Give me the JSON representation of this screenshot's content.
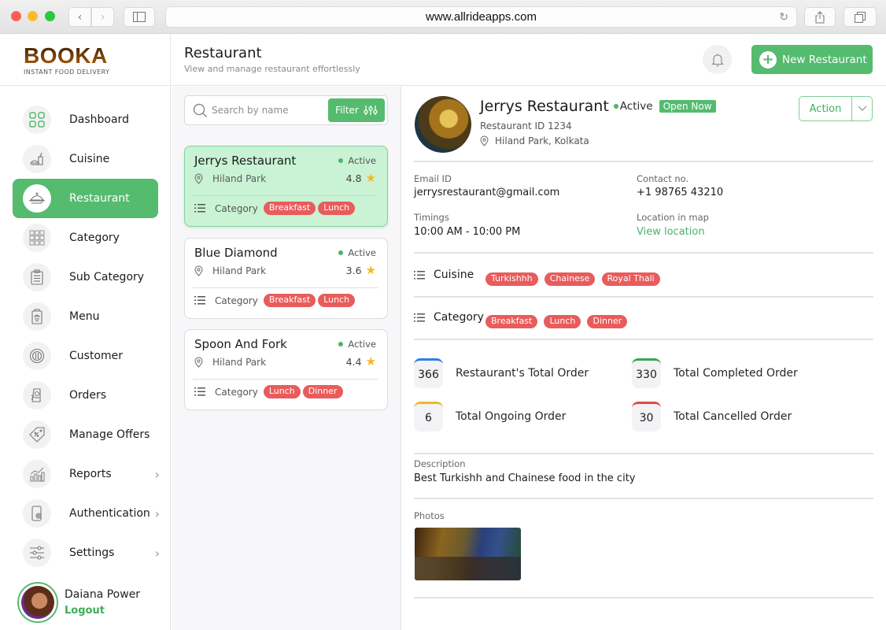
{
  "browser": {
    "url": "www.allrideapps.com"
  },
  "brand": {
    "name": "BOOKA",
    "tagline": "INSTANT FOOD DELIVERY"
  },
  "sidebar": {
    "items": [
      {
        "label": "Dashboard",
        "icon": "dashboard-icon",
        "active": false,
        "has_chevron": false
      },
      {
        "label": "Cuisine",
        "icon": "cuisine-icon",
        "active": false,
        "has_chevron": false
      },
      {
        "label": "Restaurant",
        "icon": "restaurant-cloche-icon",
        "active": true,
        "has_chevron": false
      },
      {
        "label": "Category",
        "icon": "category-grid-icon",
        "active": false,
        "has_chevron": false
      },
      {
        "label": "Sub Category",
        "icon": "clipboard-list-icon",
        "active": false,
        "has_chevron": false
      },
      {
        "label": "Menu",
        "icon": "menu-card-icon",
        "active": false,
        "has_chevron": false
      },
      {
        "label": "Customer",
        "icon": "customer-plate-icon",
        "active": false,
        "has_chevron": false
      },
      {
        "label": "Orders",
        "icon": "orders-icon",
        "active": false,
        "has_chevron": false
      },
      {
        "label": "Manage Offers",
        "icon": "offer-tag-icon",
        "active": false,
        "has_chevron": false
      },
      {
        "label": "Reports",
        "icon": "reports-chart-icon",
        "active": false,
        "has_chevron": true
      },
      {
        "label": "Authentication",
        "icon": "authentication-phone-icon",
        "active": false,
        "has_chevron": true
      },
      {
        "label": "Settings",
        "icon": "settings-sliders-icon",
        "active": false,
        "has_chevron": true
      }
    ],
    "user": {
      "name": "Daiana Power",
      "logout_label": "Logout"
    }
  },
  "header": {
    "title": "Restaurant",
    "subtitle": "View and manage restaurant effortlessly",
    "new_button_label": "New Restaurant"
  },
  "list": {
    "search_placeholder": "Search by name",
    "search_value": "",
    "filter_label": "Filter",
    "category_label": "Category",
    "restaurants": [
      {
        "name": "Jerrys Restaurant",
        "status": "Active",
        "location": "Hiland Park",
        "rating": "4.8",
        "categories": [
          "Breakfast",
          "Lunch"
        ],
        "selected": true
      },
      {
        "name": "Blue Diamond",
        "status": "Active",
        "location": "Hiland Park",
        "rating": "3.6",
        "categories": [
          "Breakfast",
          "Lunch"
        ],
        "selected": false
      },
      {
        "name": "Spoon And Fork",
        "status": "Active",
        "location": "Hiland Park",
        "rating": "4.4",
        "categories": [
          "Lunch",
          "Dinner"
        ],
        "selected": false
      }
    ]
  },
  "detail": {
    "name": "Jerrys Restaurant",
    "status": "Active",
    "open_badge": "Open Now",
    "restaurant_id": "Restaurant ID 1234",
    "location": "Hiland Park, Kolkata",
    "action_label": "Action",
    "email_label": "Email ID",
    "email": "jerrysrestaurant@gmail.com",
    "contact_label": "Contact no.",
    "contact": "+1 98765 43210",
    "timings_label": "Timings",
    "timings": "10:00 AM - 10:00 PM",
    "map_label": "Location in map",
    "map_link": "View location",
    "cuisine_label": "Cuisine",
    "cuisines": [
      "Turkishhh",
      "Chainese",
      "Royal Thali"
    ],
    "category_label": "Category",
    "categories": [
      "Breakfast",
      "Lunch",
      "Dinner"
    ],
    "stats": [
      {
        "value": "366",
        "label": "Restaurant's Total Order",
        "color": "#2f7fe0"
      },
      {
        "value": "330",
        "label": "Total Completed Order",
        "color": "#3aa655"
      },
      {
        "value": "6",
        "label": "Total Ongoing Order",
        "color": "#f2b526"
      },
      {
        "value": "30",
        "label": "Total Cancelled Order",
        "color": "#e04848"
      }
    ],
    "description_label": "Description",
    "description": "Best Turkishh and Chainese food in the city",
    "photos_label": "Photos"
  },
  "colors": {
    "accent": "#54bb6f",
    "tag": "#e85c5c",
    "star": "#f5b51b"
  }
}
